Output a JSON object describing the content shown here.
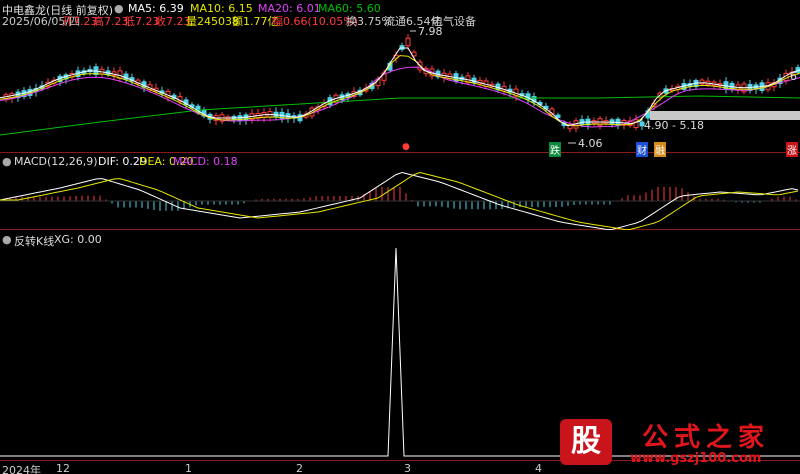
{
  "header": {
    "title": "中电鑫龙(日线 前复权)",
    "ma5": "MA5: 6.39",
    "ma10": "MA10: 6.15",
    "ma20": "MA20: 6.01",
    "ma60": "MA60: 5.60",
    "date": "2025/06/05/四",
    "open": "开7.23",
    "high": "高7.23",
    "low": "低7.23",
    "close": "收7.23",
    "volume": "量245038",
    "amount": "额1.77亿",
    "change": "幅0.66(10.05%)",
    "turnover": "换3.75%",
    "float": "流通6.54亿",
    "industry": "电气设备"
  },
  "price_panel": {
    "high_label": "7.98",
    "low_label": "4.06",
    "range_label": "4.90 - 5.18",
    "right_value": "6",
    "markers": [
      "跌",
      "财",
      "融",
      "涨"
    ]
  },
  "macd_panel": {
    "title": "MACD(12,26,9)",
    "dif": "DIF: 0.29",
    "dea": "DEA: 0.20",
    "macd": "MACD: 0.18"
  },
  "xg_panel": {
    "title": "反转K线",
    "xg": "XG: 0.00"
  },
  "axis": {
    "labels": [
      "2024年",
      "12",
      "1",
      "2",
      "3",
      "4"
    ]
  },
  "watermark": {
    "badge": "股",
    "title": "公式之家",
    "url": "www.gszj100.com"
  },
  "colors": {
    "ma5": "#ffffff",
    "ma10": "#e6e600",
    "ma20": "#e040fb",
    "ma60": "#00c000",
    "up": "#ff3b3b",
    "down": "#4fd3e8",
    "grid": "#8a1a1a"
  }
}
